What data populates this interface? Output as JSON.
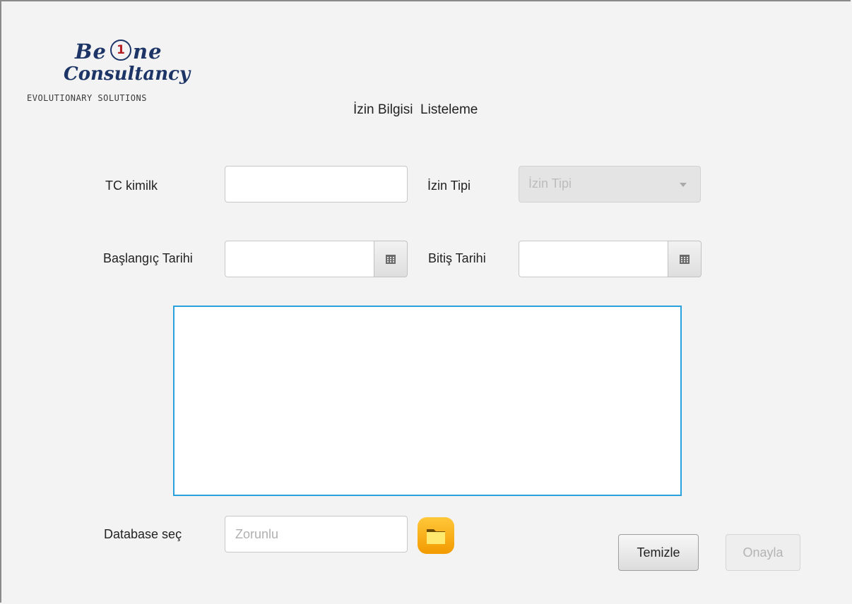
{
  "logo": {
    "line1_before": "Be",
    "circle": "1",
    "line1_after": "ne",
    "line2": "Consultancy",
    "tagline": "EVOLUTIONARY SOLUTIONS"
  },
  "title": "İzin Bilgisi  Listeleme",
  "form": {
    "tc_label": "TC kimilk",
    "tc_value": "",
    "izin_tipi_label": "İzin Tipi",
    "izin_tipi_prompt": "İzin Tipi",
    "baslangic_label": "Başlangıç Tarihi",
    "baslangic_value": "",
    "bitis_label": "Bitiş Tarihi",
    "bitis_value": "",
    "database_label": "Database seç",
    "database_placeholder": "Zorunlu"
  },
  "buttons": {
    "clear": "Temizle",
    "confirm": "Onayla"
  },
  "icons": {
    "calendar": "calendar-icon",
    "folder": "folder-icon",
    "dropdown": "chevron-down-icon"
  },
  "colors": {
    "accent_border": "#2aa1dc",
    "folder": "#f5b400",
    "logo_text": "#1d3566",
    "logo_red": "#b51e22"
  }
}
